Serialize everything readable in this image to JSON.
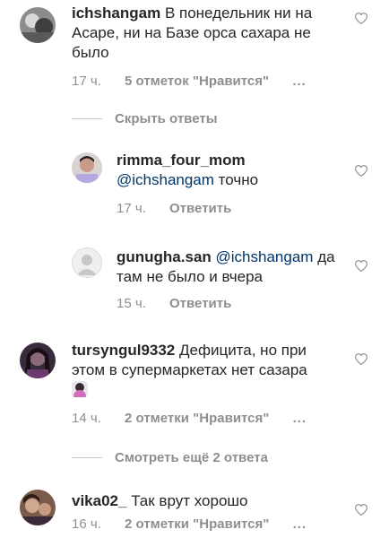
{
  "comments": [
    {
      "username": "ichshangam",
      "text": "В понедельник ни на Асаре, ни на Базе орса сахара не было",
      "time": "17 ч.",
      "likes": "5 отметок \"Нравится\"",
      "more": "..."
    },
    {
      "username": "rimma_four_mom",
      "mention": "@ichshangam",
      "text": "точно",
      "time": "17 ч.",
      "reply": "Ответить"
    },
    {
      "username": "gunugha.san",
      "mention": "@ichshangam",
      "text": "да там не было и вчера",
      "time": "15 ч.",
      "reply": "Ответить"
    },
    {
      "username": "tursyngul9332",
      "text": "Дефицита, но при этом в супермаркетах нет сазара",
      "time": "14 ч.",
      "likes": "2 отметки \"Нравится\"",
      "more": "..."
    },
    {
      "username": "vika02_",
      "text": "Так врут хорошо",
      "time": "16 ч.",
      "likes": "2 отметки \"Нравится\"",
      "more": "..."
    }
  ],
  "threads": {
    "hide_replies": "Скрыть ответы",
    "view_more": "Смотреть ещё 2 ответа"
  },
  "icons": {
    "like": "heart-outline-icon",
    "emoji": "woman-shrugging-emoji"
  },
  "colors": {
    "text": "#262626",
    "meta": "#8e8e8e",
    "mention": "#00376b"
  }
}
